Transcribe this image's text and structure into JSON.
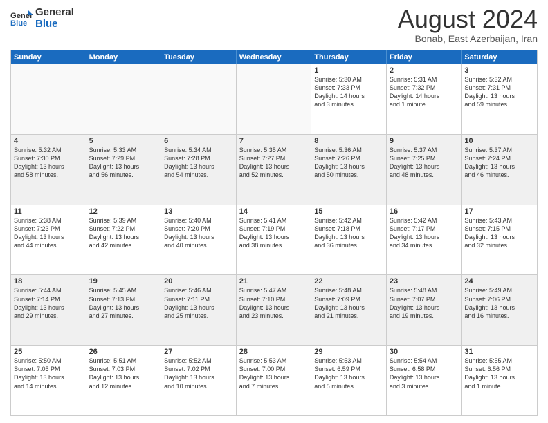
{
  "logo": {
    "line1": "General",
    "line2": "Blue"
  },
  "title": "August 2024",
  "subtitle": "Bonab, East Azerbaijan, Iran",
  "weekdays": [
    "Sunday",
    "Monday",
    "Tuesday",
    "Wednesday",
    "Thursday",
    "Friday",
    "Saturday"
  ],
  "rows": [
    [
      {
        "day": "",
        "info": ""
      },
      {
        "day": "",
        "info": ""
      },
      {
        "day": "",
        "info": ""
      },
      {
        "day": "",
        "info": ""
      },
      {
        "day": "1",
        "info": "Sunrise: 5:30 AM\nSunset: 7:33 PM\nDaylight: 14 hours\nand 3 minutes."
      },
      {
        "day": "2",
        "info": "Sunrise: 5:31 AM\nSunset: 7:32 PM\nDaylight: 14 hours\nand 1 minute."
      },
      {
        "day": "3",
        "info": "Sunrise: 5:32 AM\nSunset: 7:31 PM\nDaylight: 13 hours\nand 59 minutes."
      }
    ],
    [
      {
        "day": "4",
        "info": "Sunrise: 5:32 AM\nSunset: 7:30 PM\nDaylight: 13 hours\nand 58 minutes."
      },
      {
        "day": "5",
        "info": "Sunrise: 5:33 AM\nSunset: 7:29 PM\nDaylight: 13 hours\nand 56 minutes."
      },
      {
        "day": "6",
        "info": "Sunrise: 5:34 AM\nSunset: 7:28 PM\nDaylight: 13 hours\nand 54 minutes."
      },
      {
        "day": "7",
        "info": "Sunrise: 5:35 AM\nSunset: 7:27 PM\nDaylight: 13 hours\nand 52 minutes."
      },
      {
        "day": "8",
        "info": "Sunrise: 5:36 AM\nSunset: 7:26 PM\nDaylight: 13 hours\nand 50 minutes."
      },
      {
        "day": "9",
        "info": "Sunrise: 5:37 AM\nSunset: 7:25 PM\nDaylight: 13 hours\nand 48 minutes."
      },
      {
        "day": "10",
        "info": "Sunrise: 5:37 AM\nSunset: 7:24 PM\nDaylight: 13 hours\nand 46 minutes."
      }
    ],
    [
      {
        "day": "11",
        "info": "Sunrise: 5:38 AM\nSunset: 7:23 PM\nDaylight: 13 hours\nand 44 minutes."
      },
      {
        "day": "12",
        "info": "Sunrise: 5:39 AM\nSunset: 7:22 PM\nDaylight: 13 hours\nand 42 minutes."
      },
      {
        "day": "13",
        "info": "Sunrise: 5:40 AM\nSunset: 7:20 PM\nDaylight: 13 hours\nand 40 minutes."
      },
      {
        "day": "14",
        "info": "Sunrise: 5:41 AM\nSunset: 7:19 PM\nDaylight: 13 hours\nand 38 minutes."
      },
      {
        "day": "15",
        "info": "Sunrise: 5:42 AM\nSunset: 7:18 PM\nDaylight: 13 hours\nand 36 minutes."
      },
      {
        "day": "16",
        "info": "Sunrise: 5:42 AM\nSunset: 7:17 PM\nDaylight: 13 hours\nand 34 minutes."
      },
      {
        "day": "17",
        "info": "Sunrise: 5:43 AM\nSunset: 7:15 PM\nDaylight: 13 hours\nand 32 minutes."
      }
    ],
    [
      {
        "day": "18",
        "info": "Sunrise: 5:44 AM\nSunset: 7:14 PM\nDaylight: 13 hours\nand 29 minutes."
      },
      {
        "day": "19",
        "info": "Sunrise: 5:45 AM\nSunset: 7:13 PM\nDaylight: 13 hours\nand 27 minutes."
      },
      {
        "day": "20",
        "info": "Sunrise: 5:46 AM\nSunset: 7:11 PM\nDaylight: 13 hours\nand 25 minutes."
      },
      {
        "day": "21",
        "info": "Sunrise: 5:47 AM\nSunset: 7:10 PM\nDaylight: 13 hours\nand 23 minutes."
      },
      {
        "day": "22",
        "info": "Sunrise: 5:48 AM\nSunset: 7:09 PM\nDaylight: 13 hours\nand 21 minutes."
      },
      {
        "day": "23",
        "info": "Sunrise: 5:48 AM\nSunset: 7:07 PM\nDaylight: 13 hours\nand 19 minutes."
      },
      {
        "day": "24",
        "info": "Sunrise: 5:49 AM\nSunset: 7:06 PM\nDaylight: 13 hours\nand 16 minutes."
      }
    ],
    [
      {
        "day": "25",
        "info": "Sunrise: 5:50 AM\nSunset: 7:05 PM\nDaylight: 13 hours\nand 14 minutes."
      },
      {
        "day": "26",
        "info": "Sunrise: 5:51 AM\nSunset: 7:03 PM\nDaylight: 13 hours\nand 12 minutes."
      },
      {
        "day": "27",
        "info": "Sunrise: 5:52 AM\nSunset: 7:02 PM\nDaylight: 13 hours\nand 10 minutes."
      },
      {
        "day": "28",
        "info": "Sunrise: 5:53 AM\nSunset: 7:00 PM\nDaylight: 13 hours\nand 7 minutes."
      },
      {
        "day": "29",
        "info": "Sunrise: 5:53 AM\nSunset: 6:59 PM\nDaylight: 13 hours\nand 5 minutes."
      },
      {
        "day": "30",
        "info": "Sunrise: 5:54 AM\nSunset: 6:58 PM\nDaylight: 13 hours\nand 3 minutes."
      },
      {
        "day": "31",
        "info": "Sunrise: 5:55 AM\nSunset: 6:56 PM\nDaylight: 13 hours\nand 1 minute."
      }
    ]
  ]
}
